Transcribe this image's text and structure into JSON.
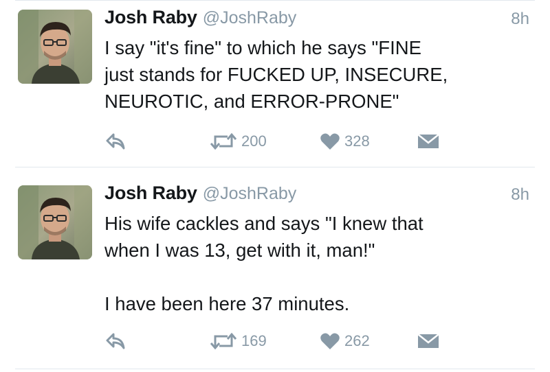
{
  "tweets": [
    {
      "author_name": "Josh Raby",
      "handle": "@JoshRaby",
      "time": "8h",
      "text": "I say \"it's fine\" to which he says \"FINE\njust stands for FUCKED UP, INSECURE,\nNEUROTIC, and ERROR-PRONE\"",
      "retweets": "200",
      "likes": "328"
    },
    {
      "author_name": "Josh Raby",
      "handle": "@JoshRaby",
      "time": "8h",
      "text": "His wife cackles and says \"I knew that\nwhen I was 13, get with it, man!\"\n\nI have been here 37 minutes.",
      "retweets": "169",
      "likes": "262"
    }
  ],
  "icons": {
    "reply": "reply-arrow-icon",
    "retweet": "retweet-icon",
    "like": "heart-icon",
    "message": "envelope-icon"
  },
  "colors": {
    "text": "#14171a",
    "muted": "#8899a6",
    "divider": "#e1e8ed"
  }
}
